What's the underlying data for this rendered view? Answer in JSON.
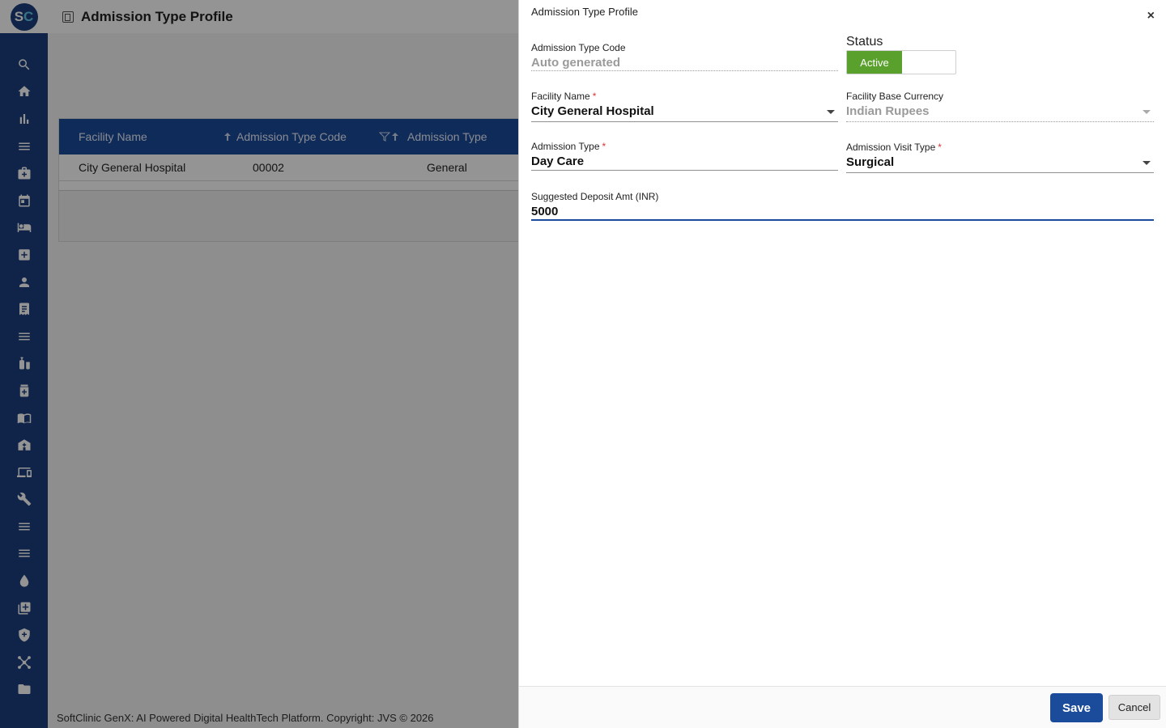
{
  "app": {
    "logo_s": "S",
    "logo_c": "C",
    "page_title": "Admission Type Profile",
    "footer": "SoftClinic GenX: AI Powered Digital HealthTech Platform. Copyright: JVS © 2026"
  },
  "sidebar": {
    "icons": [
      "search-icon",
      "home-icon",
      "bar-chart-icon",
      "menu-icon",
      "medical-bag-icon",
      "calendar-icon",
      "bed-icon",
      "medical-plus-icon",
      "person-icon",
      "receipt-icon",
      "menu-icon",
      "syringe-icon",
      "medicine-bottle-icon",
      "book-icon",
      "hospital-building-icon",
      "devices-icon",
      "wrench-icon",
      "menu-icon",
      "menu-icon",
      "drop-icon",
      "add-note-icon",
      "shield-plus-icon",
      "network-icon",
      "folder-icon"
    ]
  },
  "grid": {
    "columns": [
      "Facility Name",
      "Admission Type Code",
      "Admission Type"
    ],
    "rows": [
      {
        "facility": "City General Hospital",
        "code": "00002",
        "type": "General"
      }
    ]
  },
  "dialog": {
    "title": "Admission Type Profile",
    "close": "×",
    "code_label": "Admission Type Code",
    "code_value": "Auto generated",
    "status_label": "Status",
    "status_value": "Active",
    "facility_label": "Facility Name",
    "facility_value": "City General Hospital",
    "currency_label": "Facility Base Currency",
    "currency_value": "Indian Rupees",
    "type_label": "Admission Type",
    "type_value": "Day Care",
    "visit_label": "Admission Visit Type",
    "visit_value": "Surgical",
    "deposit_label": "Suggested Deposit Amt (INR)",
    "deposit_value": "5000",
    "required_mark": "*",
    "save": "Save",
    "cancel": "Cancel"
  },
  "colors": {
    "brand": "#1b3f7d",
    "grid_header": "#1b4b9b",
    "status_active": "#5aa02c",
    "required": "#d33333"
  }
}
